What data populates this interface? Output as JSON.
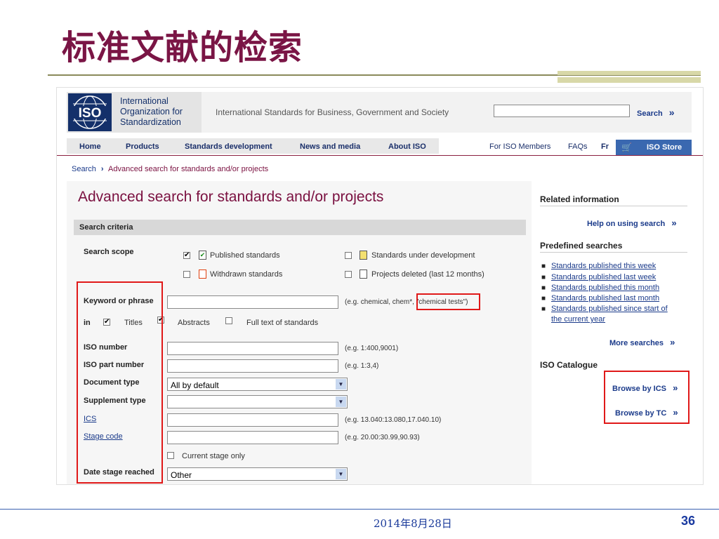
{
  "slide": {
    "title": "标准文献的检索",
    "date": "2014年8月28日",
    "page_number": "36",
    "colors": {
      "title": "#7a1545",
      "footer_text": "#1a3a9a",
      "highlight_box": "#e01818"
    }
  },
  "iso": {
    "logo_text": "ISO",
    "org_name": [
      "International",
      "Organization for",
      "Standardization"
    ],
    "tagline": "International Standards for Business, Government and Society",
    "search_value": "",
    "search_button": "Search",
    "nav": [
      "Home",
      "Products",
      "Standards development",
      "News and media",
      "About ISO"
    ],
    "nav_right": [
      "For ISO Members",
      "FAQs",
      "Fr"
    ],
    "store": "ISO Store",
    "breadcrumb": {
      "root": "Search",
      "current": "Advanced search for standards and/or projects"
    },
    "page_title": "Advanced search for standards and/or projects",
    "criteria_bar": "Search criteria",
    "search_scope": {
      "label": "Search scope",
      "options": [
        {
          "label": "Published standards",
          "checked": true
        },
        {
          "label": "Standards under development",
          "checked": false
        },
        {
          "label": "Withdrawn standards",
          "checked": false
        },
        {
          "label": "Projects deleted (last 12 months)",
          "checked": false
        }
      ]
    },
    "keyword": {
      "label": "Keyword or phrase",
      "value": "",
      "hint_prefix": "(e.g. chemical, chem*, ",
      "hint_highlight": "\"chemical tests\")"
    },
    "in_row": {
      "label": "in",
      "options": [
        {
          "label": "Titles",
          "checked": true
        },
        {
          "label": "Abstracts",
          "checked": true
        },
        {
          "label": "Full text of standards",
          "checked": false
        }
      ]
    },
    "fields": [
      {
        "label": "ISO number",
        "value": "",
        "hint": "(e.g. 1:400,9001)"
      },
      {
        "label": "ISO part number",
        "value": "",
        "hint": "(e.g. 1:3,4)"
      },
      {
        "label": "ICS",
        "value": "",
        "hint": "(e.g. 13.040:13.080,17.040.10)"
      },
      {
        "label": "Stage code",
        "value": "",
        "hint": "(e.g. 20.00:30.99,90.93)"
      }
    ],
    "document_type": {
      "label": "Document type",
      "value": "All by default"
    },
    "supplement_type": {
      "label": "Supplement type",
      "value": ""
    },
    "current_stage_only": {
      "label": "Current stage only",
      "checked": false
    },
    "date_stage": {
      "label": "Date stage reached",
      "value": "Other"
    },
    "sidebar": {
      "related_heading": "Related information",
      "help_link": "Help on using search",
      "predefined_heading": "Predefined searches",
      "predefined": [
        "Standards published this week",
        "Standards published last week",
        "Standards published this month",
        "Standards published last month",
        "Standards published since start of"
      ],
      "predefined_cont": "the current year",
      "more_searches": "More searches",
      "catalogue_heading": "ISO Catalogue",
      "browse_ics": "Browse by ICS",
      "browse_tc": "Browse by TC"
    },
    "glyphs": {
      "chevron": "»",
      "breadcrumb_arrow": "›",
      "check": "✔",
      "cart": "🛒",
      "select_arrow": "▼"
    }
  }
}
